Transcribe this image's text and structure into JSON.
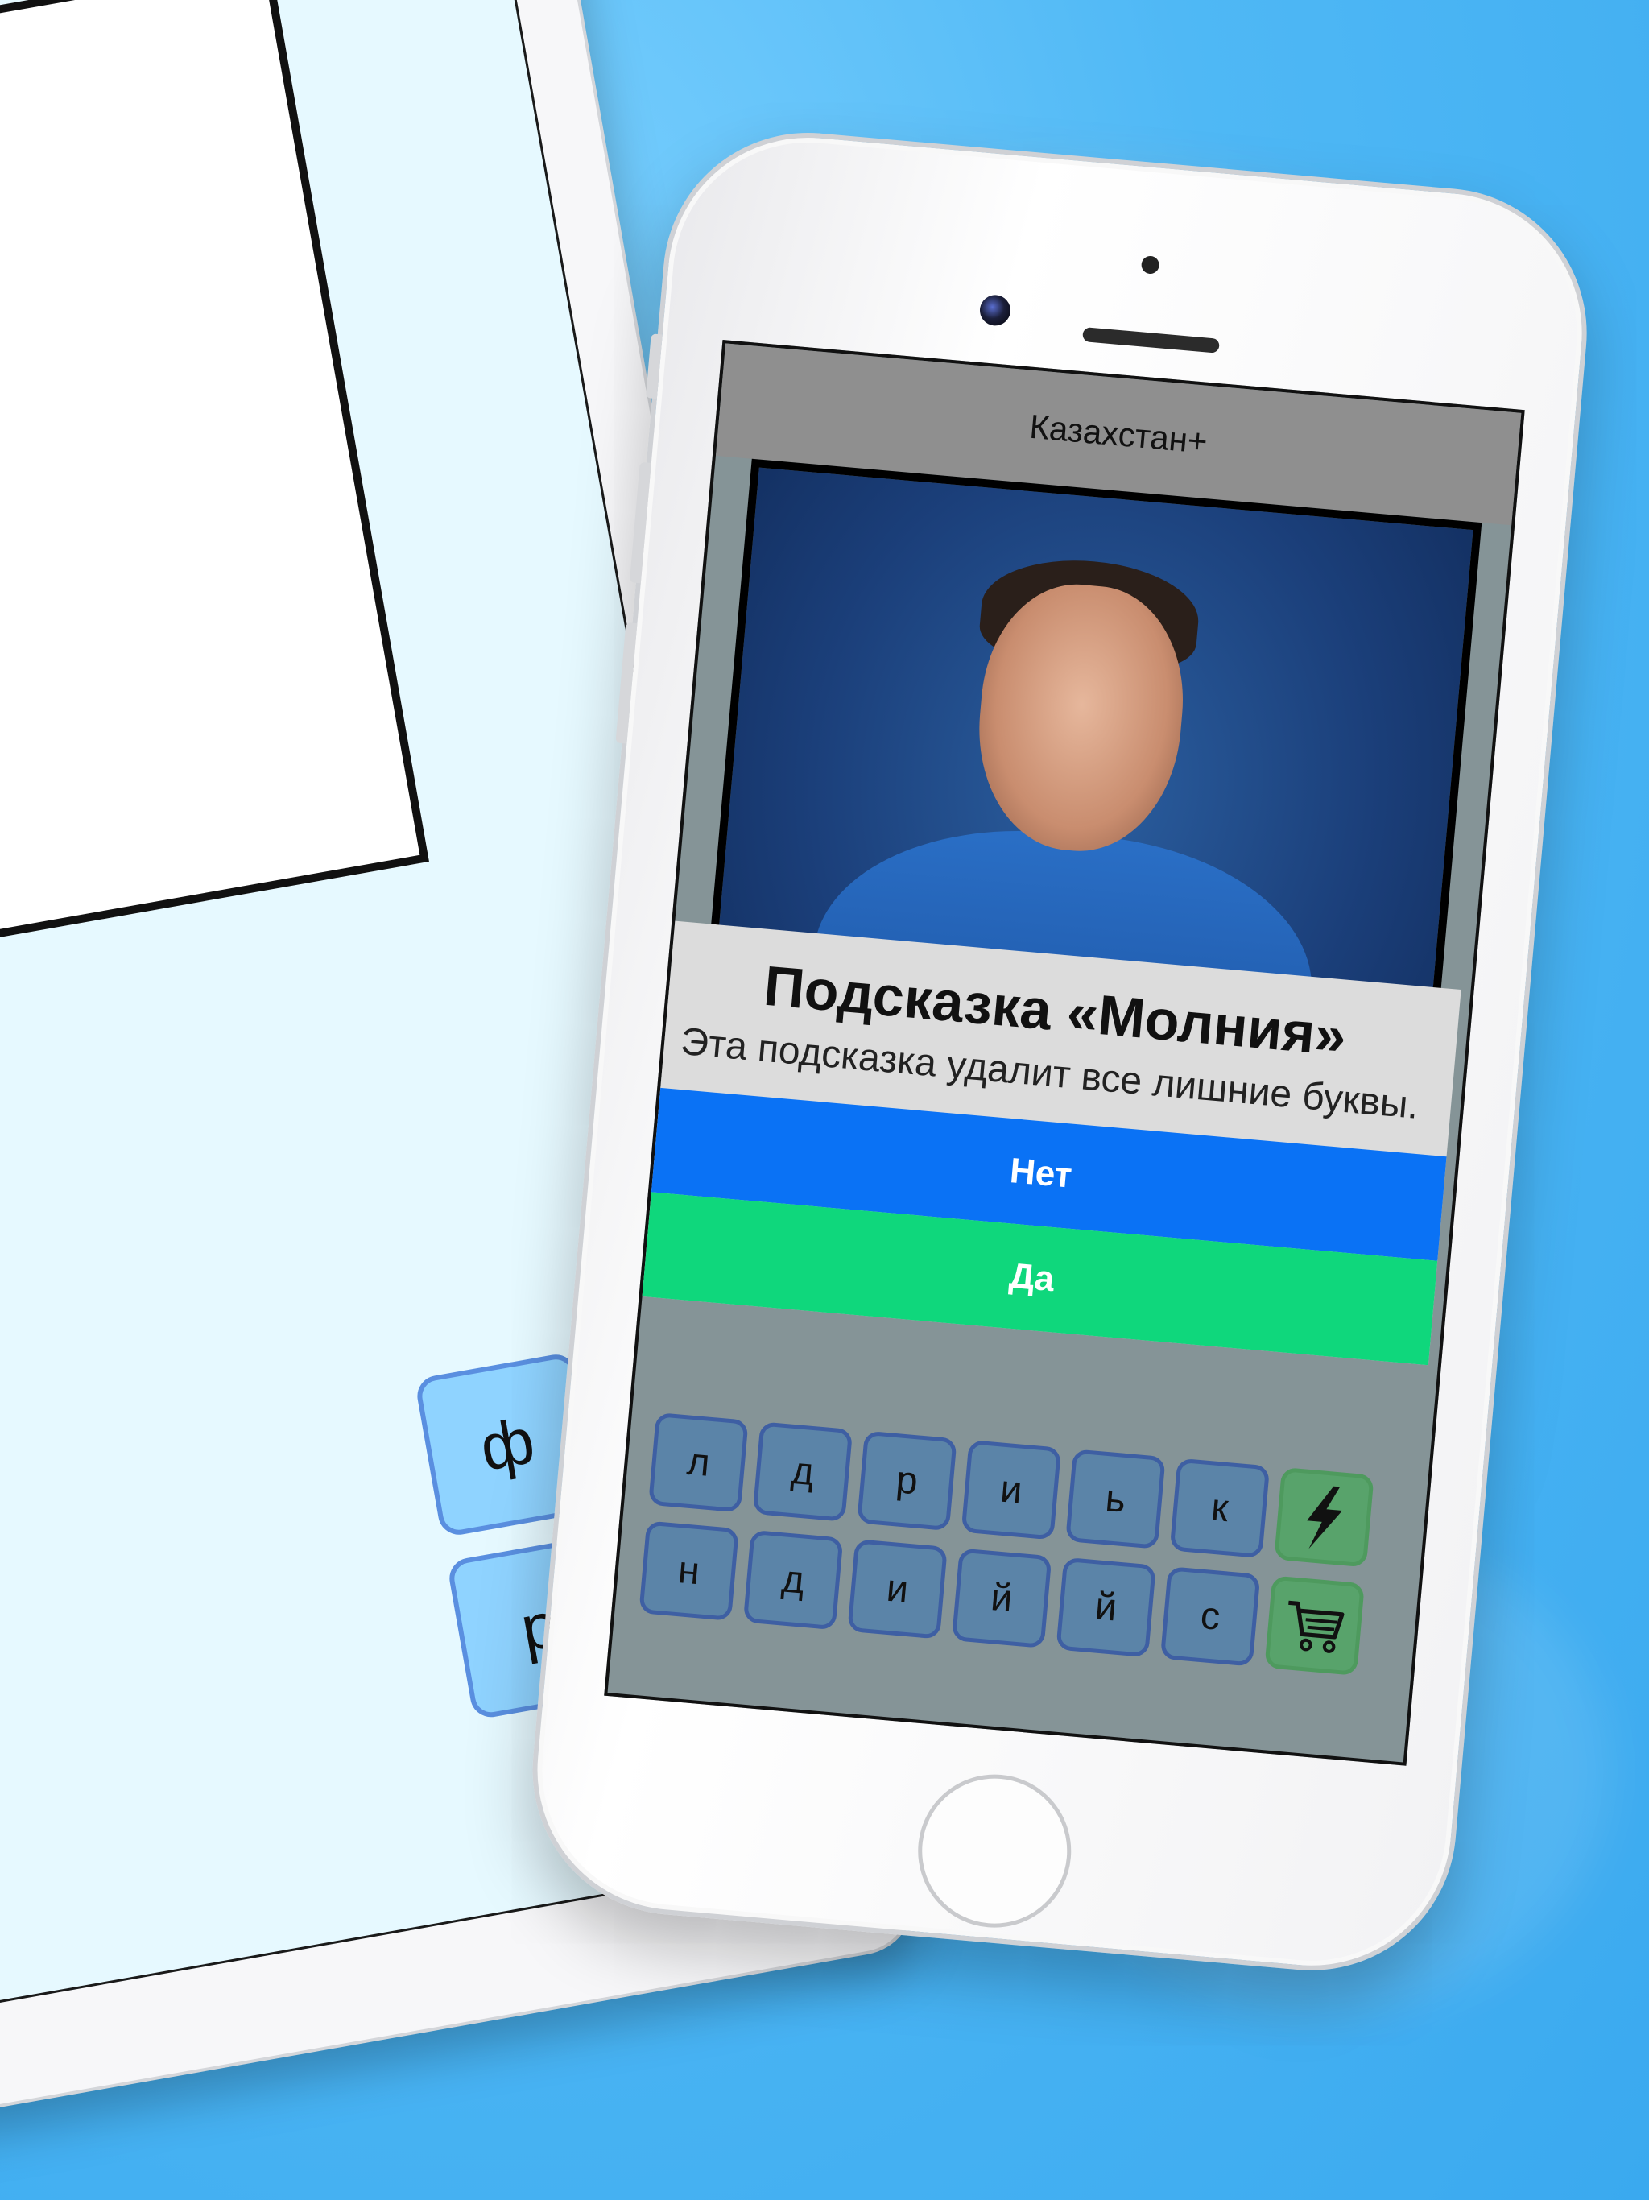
{
  "app": {
    "title": "Казахстан+"
  },
  "dialog": {
    "title": "Подсказка «Молния»",
    "message": "Эта подсказка удалит все лишние буквы.",
    "no_label": "Нет",
    "yes_label": "Да"
  },
  "phone_keyboard": {
    "row1": [
      "л",
      "д",
      "р",
      "и",
      "ь",
      "к"
    ],
    "row2": [
      "н",
      "д",
      "и",
      "й",
      "й",
      "с"
    ]
  },
  "tablet_keyboard": {
    "row1": [
      "ф"
    ],
    "row2": [
      "р"
    ]
  },
  "icons": {
    "lightning": "lightning-icon",
    "cart": "cart-icon"
  },
  "colors": {
    "background": "#4fb8f5",
    "no_button": "#0a72f5",
    "yes_button": "#0fd77c",
    "phone_screen": "#859497",
    "tablet_screen": "#e6f9ff"
  }
}
